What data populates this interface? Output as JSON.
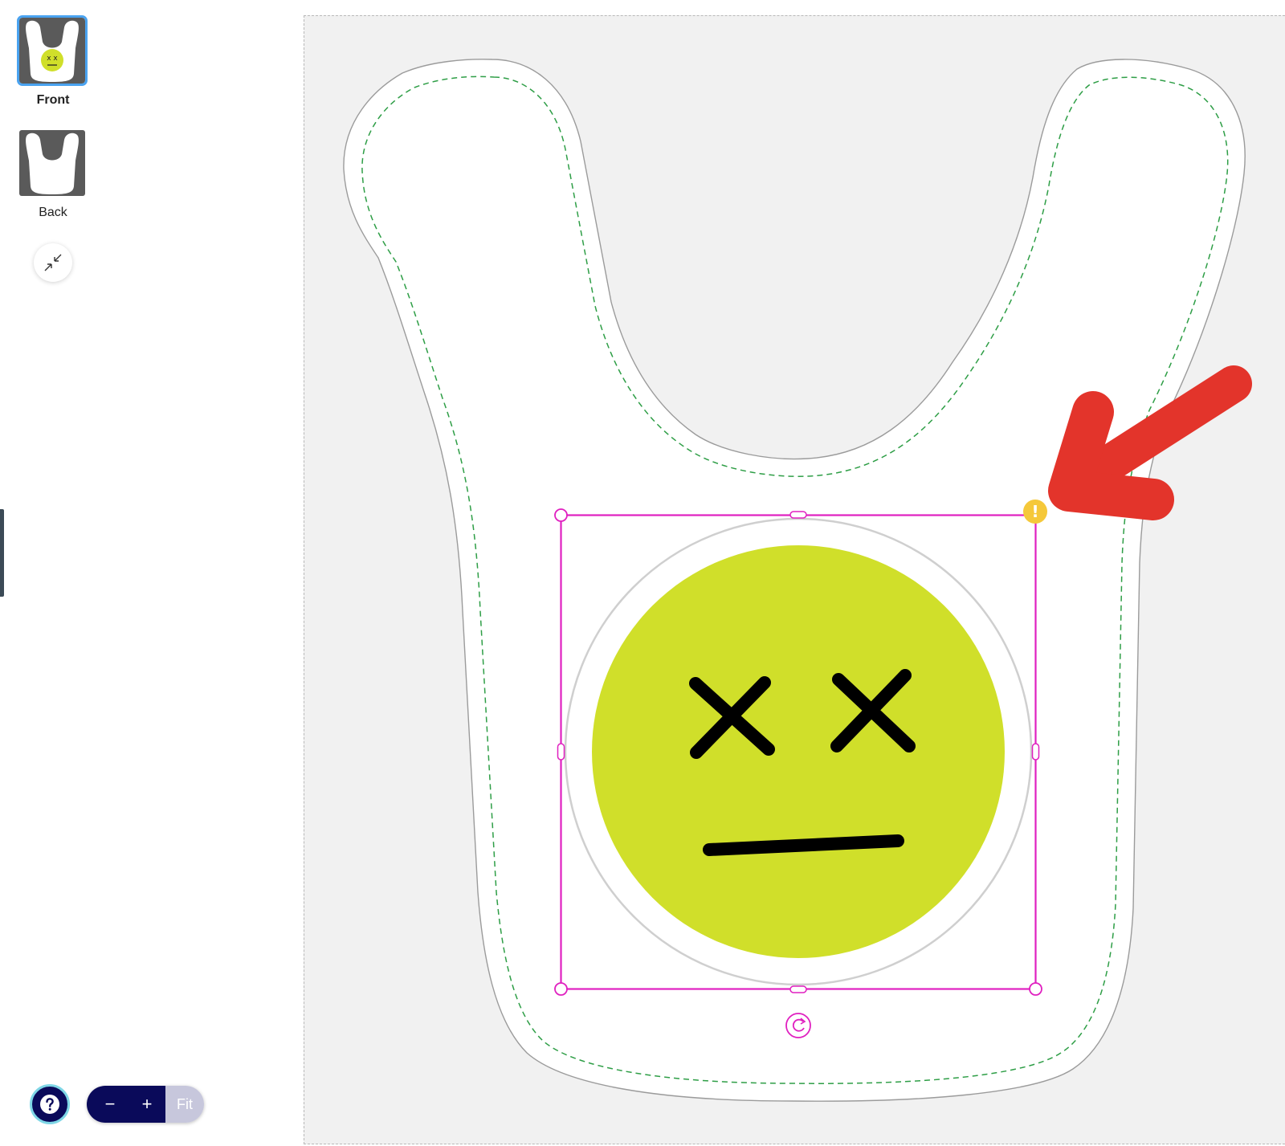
{
  "views": [
    {
      "label": "Front",
      "selected": true
    },
    {
      "label": "Back",
      "selected": false
    }
  ],
  "help": {
    "icon": "question-icon"
  },
  "zoom": {
    "minus_label": "−",
    "plus_label": "+",
    "fit_label": "Fit"
  },
  "canvas": {
    "product": "bib",
    "design": "dizzy-face-emoji",
    "warning_icon": "exclamation-icon",
    "warning_symbol": "!",
    "annotation": "arrow-pointer",
    "colors": {
      "selection": "#e020c0",
      "warning": "#f5c83a",
      "face": "#d0df2a",
      "arrow": "#e3342b",
      "safe_line": "#2e9e46",
      "canvas_bg": "#f1f1f1"
    }
  }
}
